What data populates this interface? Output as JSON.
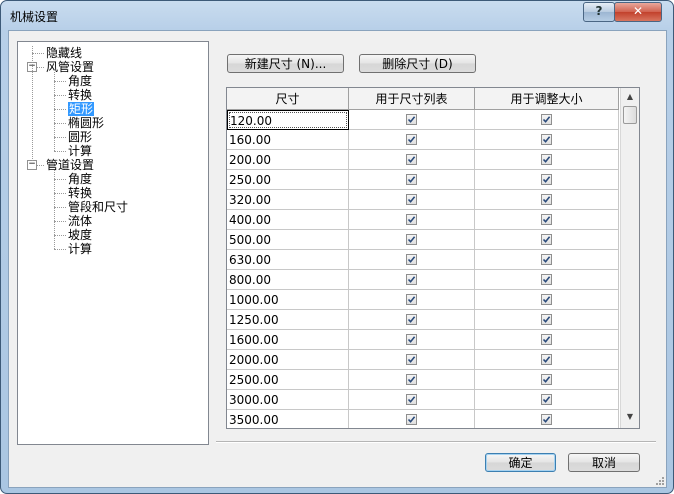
{
  "window": {
    "title": "机械设置",
    "help_label": "?",
    "close_label": "✕"
  },
  "tree": {
    "items": [
      {
        "label": "隐藏线",
        "expander": ""
      },
      {
        "label": "风管设置",
        "expander": "−"
      },
      {
        "label": "角度",
        "expander": ""
      },
      {
        "label": "转换",
        "expander": ""
      },
      {
        "label": "矩形",
        "expander": "",
        "selected": true
      },
      {
        "label": "椭圆形",
        "expander": ""
      },
      {
        "label": "圆形",
        "expander": ""
      },
      {
        "label": "计算",
        "expander": ""
      },
      {
        "label": "管道设置",
        "expander": "−"
      },
      {
        "label": "角度",
        "expander": ""
      },
      {
        "label": "转换",
        "expander": ""
      },
      {
        "label": "管段和尺寸",
        "expander": ""
      },
      {
        "label": "流体",
        "expander": ""
      },
      {
        "label": "坡度",
        "expander": ""
      },
      {
        "label": "计算",
        "expander": ""
      }
    ]
  },
  "toolbar": {
    "new_size_label": "新建尺寸 (N)...",
    "delete_size_label": "删除尺寸 (D)"
  },
  "grid": {
    "columns": [
      "尺寸",
      "用于尺寸列表",
      "用于调整大小"
    ],
    "rows": [
      {
        "size": "120.00",
        "in_list": true,
        "in_sizing": true
      },
      {
        "size": "160.00",
        "in_list": true,
        "in_sizing": true
      },
      {
        "size": "200.00",
        "in_list": true,
        "in_sizing": true
      },
      {
        "size": "250.00",
        "in_list": true,
        "in_sizing": true
      },
      {
        "size": "320.00",
        "in_list": true,
        "in_sizing": true
      },
      {
        "size": "400.00",
        "in_list": true,
        "in_sizing": true
      },
      {
        "size": "500.00",
        "in_list": true,
        "in_sizing": true
      },
      {
        "size": "630.00",
        "in_list": true,
        "in_sizing": true
      },
      {
        "size": "800.00",
        "in_list": true,
        "in_sizing": true
      },
      {
        "size": "1000.00",
        "in_list": true,
        "in_sizing": true
      },
      {
        "size": "1250.00",
        "in_list": true,
        "in_sizing": true
      },
      {
        "size": "1600.00",
        "in_list": true,
        "in_sizing": true
      },
      {
        "size": "2000.00",
        "in_list": true,
        "in_sizing": true
      },
      {
        "size": "2500.00",
        "in_list": true,
        "in_sizing": true
      },
      {
        "size": "3000.00",
        "in_list": true,
        "in_sizing": true
      },
      {
        "size": "3500.00",
        "in_list": true,
        "in_sizing": true
      }
    ],
    "scroll_up": "▲",
    "scroll_down": "▼"
  },
  "footer": {
    "ok_label": "确定",
    "cancel_label": "取消"
  },
  "colors": {
    "selection": "#3399ff",
    "title_bar": "#b7cfe8",
    "close_button": "#c2412c"
  }
}
